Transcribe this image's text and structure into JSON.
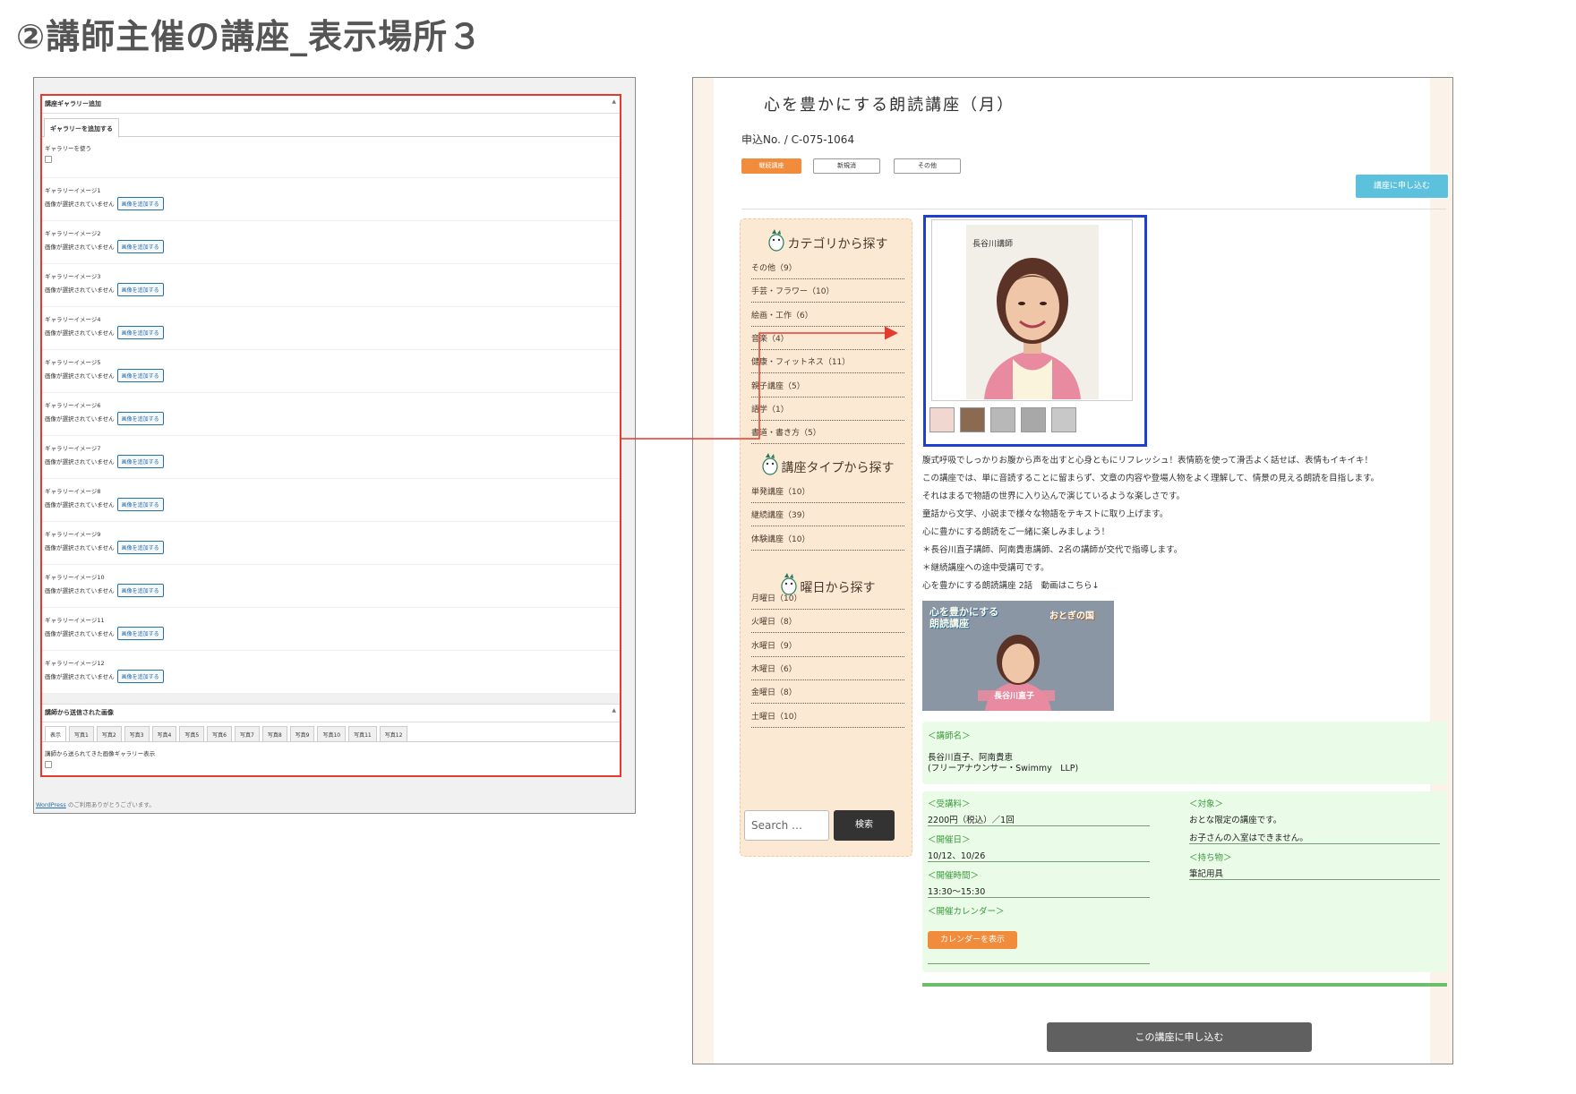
{
  "slide_title": "②講師主催の講座_表示場所３",
  "admin": {
    "gallery_section_title": "講座ギャラリー追加",
    "tab_label": "ギャラリーを追加する",
    "use_gallery_label": "ギャラリーを使う",
    "no_image_text": "画像が選択されていません",
    "add_image_button": "画像を追加する",
    "gallery_images": [
      "ギャラリーイメージ1",
      "ギャラリーイメージ2",
      "ギャラリーイメージ3",
      "ギャラリーイメージ4",
      "ギャラリーイメージ5",
      "ギャラリーイメージ6",
      "ギャラリーイメージ7",
      "ギャラリーイメージ8",
      "ギャラリーイメージ9",
      "ギャラリーイメージ10",
      "ギャラリーイメージ11",
      "ギャラリーイメージ12"
    ],
    "sent_section_title": "講師から送信された画像",
    "photo_tabs": [
      "表示",
      "写真1",
      "写真2",
      "写真3",
      "写真4",
      "写真5",
      "写真6",
      "写真7",
      "写真8",
      "写真9",
      "写真10",
      "写真11",
      "写真12"
    ],
    "sent_display_label": "講師から送られてきた画像ギャラリー表示",
    "footer_link": "WordPress",
    "footer_text": " のご利用ありがとうございます。"
  },
  "front": {
    "course_title": "心を豊かにする朗読講座（月）",
    "app_no": "申込No. / C-075-1064",
    "tags": [
      "継続講座",
      "新規消",
      "その他"
    ],
    "apply_top": "講座に申し込む",
    "sidebar": {
      "category_heading": "カテゴリから探す",
      "categories": [
        "その他（9）",
        "手芸・フラワー（10）",
        "絵画・工作（6）",
        "音楽（4）",
        "健康・フィットネス（11）",
        "親子講座（5）",
        "語学（1）",
        "書道・書き方（5）"
      ],
      "type_heading": "講座タイプから探す",
      "types": [
        "単発講座（10）",
        "継続講座（39）",
        "体験講座（10）"
      ],
      "weekday_heading": "曜日から探す",
      "weekdays": [
        "月曜日（10）",
        "火曜日（8）",
        "水曜日（9）",
        "木曜日（6）",
        "金曜日（8）",
        "土曜日（10）"
      ],
      "search_placeholder": "Search …",
      "search_button": "検索"
    },
    "gallery": {
      "portrait_label": "長谷川講師",
      "thumbnail_count": 5
    },
    "description": [
      "腹式呼吸でしっかりお腹から声を出すと心身ともにリフレッシュ！表情筋を使って滑舌よく話せば、表情もイキイキ！",
      "この講座では、単に音読することに留まらず、文章の内容や登場人物をよく理解して、情景の見える朗読を目指します。",
      "それはまるで物語の世界に入り込んで演じているような楽しさです。",
      "童話から文学、小説まで様々な物語をテキストに取り上げます。",
      "心に豊かにする朗読をご一緒に楽しみましょう！",
      "＊長谷川直子講師、阿南貴恵講師、2名の講師が交代で指導します。",
      "＊継続講座への途中受講可です。",
      "心を豊かにする朗読講座 2話　動画はこちら↓"
    ],
    "video": {
      "caption_left": "心を豊かにする\n朗読講座",
      "caption_right": "おとぎの国",
      "name_plate": "長谷川直子"
    },
    "instructor": {
      "label": "＜講師名＞",
      "name": "長谷川直子、阿南貴恵",
      "affiliation": "(フリーアナウンサー・Swimmy　LLP)"
    },
    "details": {
      "fee_label": "＜受講料＞",
      "fee": "2200円（税込）／1回",
      "dates_label": "＜開催日＞",
      "dates": "10/12、10/26",
      "time_label": "＜開催時間＞",
      "time": "13:30〜15:30",
      "calendar_label": "＜開催カレンダー＞",
      "calendar_button": "カレンダーを表示",
      "target_label": "＜対象＞",
      "target_1": "おとな限定の講座です。",
      "target_2": "お子さんの入室はできません。",
      "items_label": "＜持ち物＞",
      "items": "筆記用具"
    },
    "apply_bottom": "この講座に申し込む"
  },
  "colors": {
    "highlight_red": "#e43a2f",
    "highlight_blue": "#1e3fd0",
    "accent_orange": "#f08c3c",
    "apply_blue": "#5cc1dc",
    "info_green_bg": "#eafbe8",
    "info_green_text": "#3a9a3a",
    "sidebar_bg": "#fbe9d4"
  }
}
